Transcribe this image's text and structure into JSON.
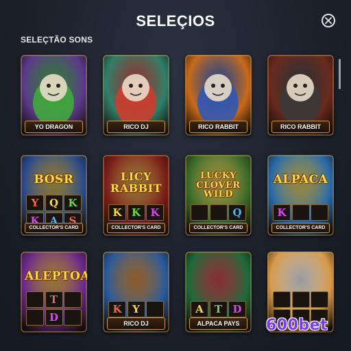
{
  "header": {
    "title": "SELEÇIOS",
    "close_icon": "close-circle-icon",
    "section_label": "SELEÇTÃO SONS"
  },
  "cards": [
    {
      "label": "YO DRAGON",
      "bg": "#5b3a8a",
      "accent": "#3fae3a",
      "icon": "dragon-icon"
    },
    {
      "label": "RICO DJ",
      "bg": "#2f7f6a",
      "accent": "#d33b2b",
      "icon": "rabbit-dj-icon"
    },
    {
      "label": "RICO RABBIT",
      "bg": "#c86a1a",
      "accent": "#2b57b8",
      "icon": "rabbit-icon"
    },
    {
      "label": "RICO RABBIT",
      "bg": "#6a2a1e",
      "accent": "#3a3a3a",
      "icon": "gorilla-icon"
    },
    {
      "label": "COLLECTOR'S CARD",
      "bg": "#2a4a8a",
      "accent": "#d8b13a",
      "logo": "BOSR",
      "reels": [
        "Y",
        "Q",
        "K",
        "K",
        "A",
        "S"
      ],
      "icon": "slot-reels-icon"
    },
    {
      "label": "COLLECTOR'S CARD",
      "bg": "#7a1e1a",
      "accent": "#e0a83a",
      "logo": "LICY RABBIT",
      "reels": [
        "K",
        "K",
        "K"
      ],
      "icon": "slot-reels-icon"
    },
    {
      "label": "COLLECTOR'S CARD",
      "bg": "#3a6a2a",
      "accent": "#f0d24a",
      "logo": "LUCKY CLOVER WILD",
      "reels": [
        "",
        "",
        "Q"
      ],
      "icon": "clover-icon"
    },
    {
      "label": "COLLECTOR'S CARD",
      "bg": "#2a6aa8",
      "accent": "#f0d24a",
      "logo": "ALPACA",
      "reels": [
        "K",
        "",
        ""
      ],
      "icon": "panda-icon"
    },
    {
      "label": "",
      "bg": "#6a2a8a",
      "accent": "#f0b63a",
      "logo": "ALEPTOA",
      "reels": [
        "",
        "T",
        "",
        "",
        "D",
        ""
      ],
      "icon": "slot-reels-icon"
    },
    {
      "label": "RICO DJ",
      "bg": "#2a5a9a",
      "accent": "#e08a2a",
      "reels": [
        "K",
        "Y",
        ""
      ],
      "icon": "monkey-icon"
    },
    {
      "label": "ALPACA PAYS",
      "bg": "#1e6a3a",
      "accent": "#d83a3a",
      "reels": [
        "A",
        "T",
        "D"
      ],
      "icon": "fruit-icon"
    },
    {
      "label": "",
      "bg": "#d89a4a",
      "accent": "#ffffff",
      "reels": [
        "",
        "",
        "",
        "",
        "",
        ""
      ],
      "icon": "alpaca-icon"
    }
  ],
  "watermark": "600bet"
}
